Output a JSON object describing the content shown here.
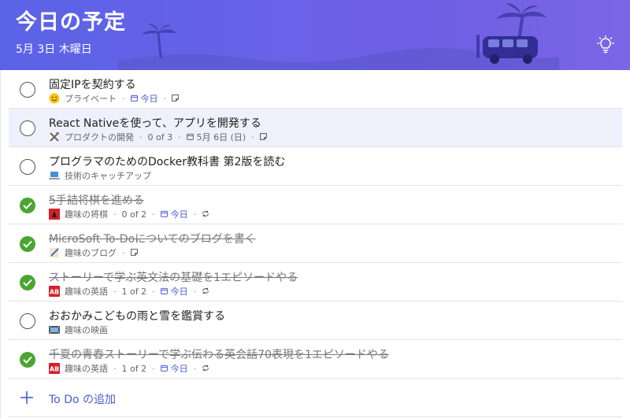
{
  "header": {
    "title": "今日の予定",
    "date": "5月 3日 木曜日",
    "colors": {
      "gradient_start": "#5a63e6",
      "gradient_end": "#7b66e6"
    }
  },
  "tasks": [
    {
      "title": "固定IPを契約する",
      "done": false,
      "selected": false,
      "list_icon": "smiley-emoji",
      "list": "プライベート",
      "steps": "",
      "due": "今日",
      "due_is_today": true,
      "repeat": false,
      "note": true
    },
    {
      "title": "React Nativeを使って、アプリを開発する",
      "done": false,
      "selected": true,
      "list_icon": "tools-emoji",
      "list": "プロダクトの開発",
      "steps": "0 of 3",
      "due": "5月 6日 (日)",
      "due_is_today": false,
      "repeat": false,
      "note": true
    },
    {
      "title": "プログラマのためのDocker教科書 第2版を読む",
      "done": false,
      "selected": false,
      "list_icon": "laptop-emoji",
      "list": "技術のキャッチアップ",
      "steps": "",
      "due": "",
      "due_is_today": false,
      "repeat": false,
      "note": false
    },
    {
      "title": "5手詰将棋を進める",
      "done": true,
      "selected": false,
      "list_icon": "shogi-emoji",
      "list": "趣味の将棋",
      "steps": "0 of 2",
      "due": "今日",
      "due_is_today": true,
      "repeat": true,
      "note": false
    },
    {
      "title": "MicroSoft To-Doについてのブログを書く",
      "done": true,
      "selected": false,
      "list_icon": "memo-emoji",
      "list": "趣味のブログ",
      "steps": "",
      "due": "",
      "due_is_today": false,
      "repeat": false,
      "note": true
    },
    {
      "title": "ストーリーで学ぶ英文法の基礎を1エピソードやる",
      "done": true,
      "selected": false,
      "list_icon": "ab-emoji",
      "list": "趣味の英語",
      "steps": "1 of 2",
      "due": "今日",
      "due_is_today": true,
      "repeat": true,
      "note": false
    },
    {
      "title": "おおかみこどもの雨と雪を鑑賞する",
      "done": false,
      "selected": false,
      "list_icon": "film-emoji",
      "list": "趣味の映画",
      "steps": "",
      "due": "",
      "due_is_today": false,
      "repeat": false,
      "note": false
    },
    {
      "title": "千夏の青春ストーリーで学ぶ伝わる英会話70表現を1エピソードやる",
      "done": true,
      "selected": false,
      "list_icon": "ab-emoji",
      "list": "趣味の英語",
      "steps": "1 of 2",
      "due": "今日",
      "due_is_today": true,
      "repeat": true,
      "note": false
    }
  ],
  "add_todo": {
    "label": "To Do の追加"
  },
  "icons": {
    "bulb": "lightbulb-icon",
    "add": "plus-icon",
    "calendar": "calendar-icon",
    "note": "note-icon",
    "repeat": "repeat-icon",
    "check": "checkmark-icon"
  },
  "colors": {
    "accent": "#4a5cd4",
    "complete": "#4aa531",
    "selected_row": "#eef1fb"
  }
}
